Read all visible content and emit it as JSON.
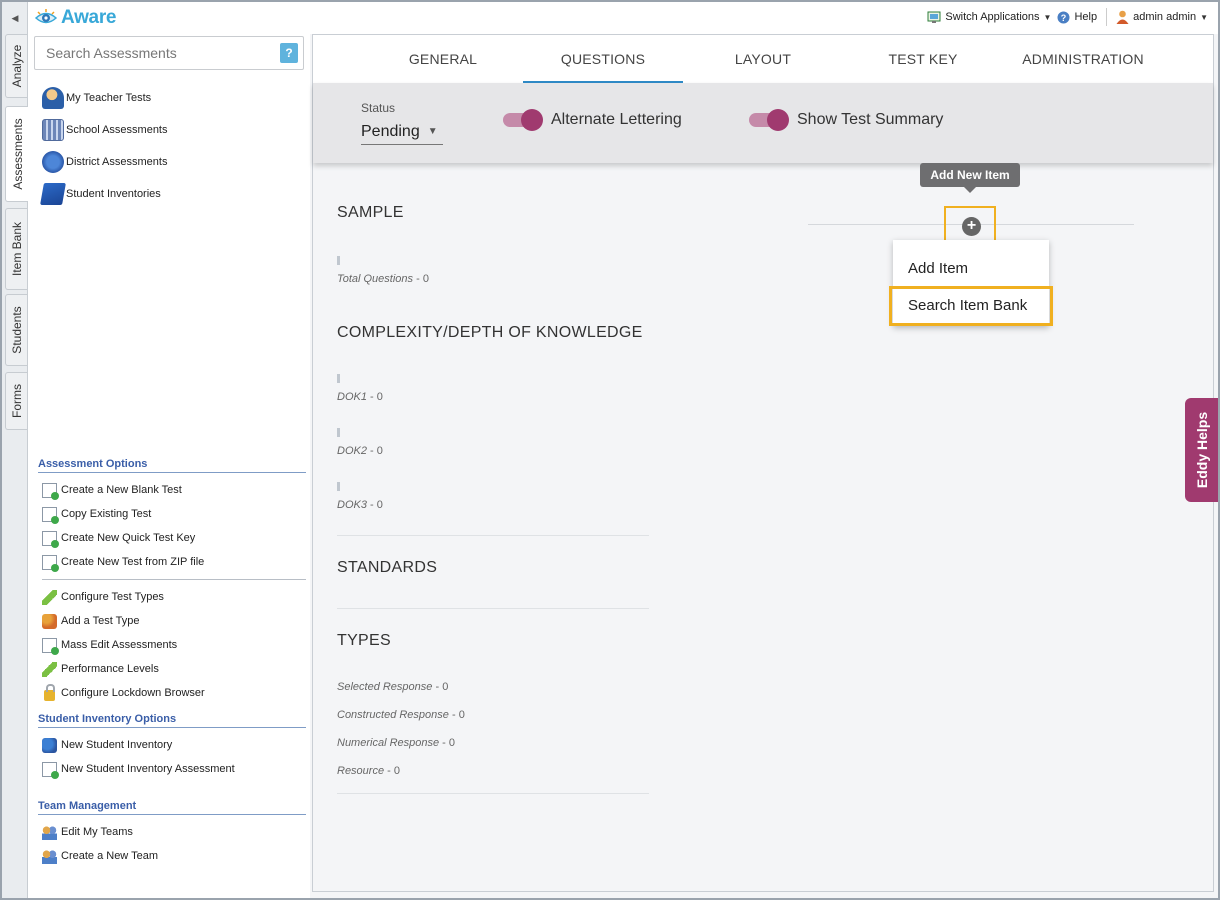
{
  "app": {
    "name": "Aware"
  },
  "topbar": {
    "switch_apps": "Switch Applications",
    "help": "Help",
    "user": "admin admin"
  },
  "vtabs": [
    "Analyze",
    "Assessments",
    "Item Bank",
    "Students",
    "Forms"
  ],
  "sidebar": {
    "search_placeholder": "Search Assessments",
    "search_help": "?",
    "nav": [
      {
        "label": "My Teacher Tests",
        "icon": "teacher-icon"
      },
      {
        "label": "School Assessments",
        "icon": "school-icon"
      },
      {
        "label": "District Assessments",
        "icon": "globe-icon"
      },
      {
        "label": "Student Inventories",
        "icon": "book-icon"
      }
    ],
    "assessment_options": {
      "heading": "Assessment Options",
      "group1": [
        "Create a New Blank Test",
        "Copy Existing Test",
        "Create New Quick Test Key",
        "Create New Test from ZIP file"
      ],
      "group2": [
        "Configure Test Types",
        "Add a Test Type",
        "Mass Edit Assessments",
        "Performance Levels",
        "Configure Lockdown Browser"
      ]
    },
    "student_inventory_options": {
      "heading": "Student Inventory Options",
      "items": [
        "New Student Inventory",
        "New Student Inventory Assessment"
      ]
    },
    "team_management": {
      "heading": "Team Management",
      "items": [
        "Edit My Teams",
        "Create a New Team"
      ]
    }
  },
  "main": {
    "tabs": [
      "GENERAL",
      "QUESTIONS",
      "LAYOUT",
      "TEST KEY",
      "ADMINISTRATION"
    ],
    "active_tab": "QUESTIONS",
    "status_label": "Status",
    "status_value": "Pending",
    "toggles": [
      {
        "label": "Alternate Lettering",
        "on": true
      },
      {
        "label": "Show Test Summary",
        "on": true
      }
    ],
    "tooltip": "Add New Item",
    "add_menu": [
      "Add Item",
      "Search Item Bank"
    ],
    "sections": {
      "sample_title": "SAMPLE",
      "total_questions_label": "Total Questions",
      "total_questions": "- 0",
      "complexity_title": "COMPLEXITY/DEPTH OF KNOWLEDGE",
      "dok": [
        {
          "label": "DOK1",
          "value": "- 0"
        },
        {
          "label": "DOK2",
          "value": "- 0"
        },
        {
          "label": "DOK3",
          "value": "- 0"
        }
      ],
      "standards_title": "STANDARDS",
      "types_title": "TYPES",
      "types": [
        {
          "label": "Selected Response",
          "value": "- 0"
        },
        {
          "label": "Constructed Response",
          "value": "- 0"
        },
        {
          "label": "Numerical Response",
          "value": "- 0"
        },
        {
          "label": "Resource",
          "value": "- 0"
        }
      ]
    }
  },
  "eddy": "Eddy Helps",
  "colors": {
    "accent": "#2f8bc8",
    "toggle": "#a03a6f",
    "highlight": "#f0b020",
    "section_heading": "#3a5ea8"
  }
}
